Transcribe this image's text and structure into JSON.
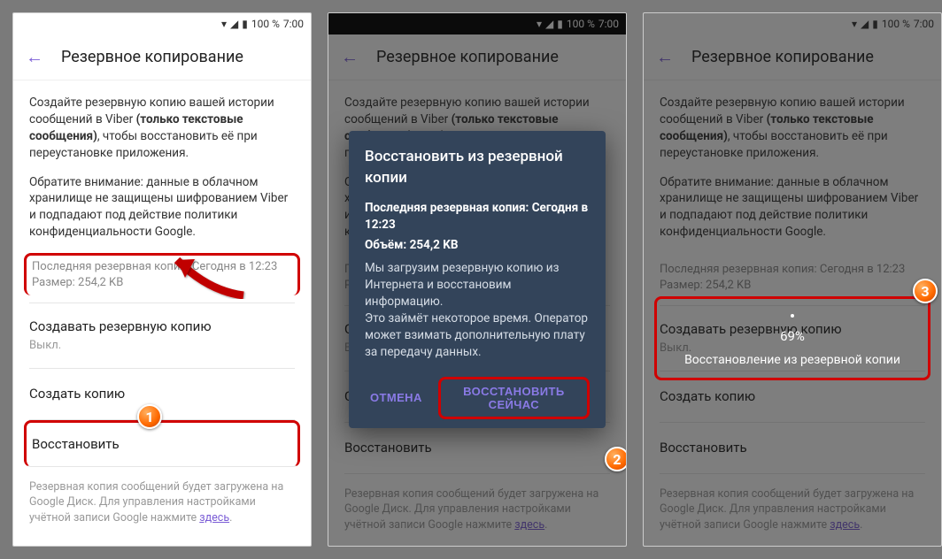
{
  "status": {
    "battery": "100 %",
    "time": "7:00"
  },
  "appbar": {
    "title": "Резервное копирование"
  },
  "desc": {
    "line1_pre": "Создайте резервную копию вашей истории сообщений в Viber ",
    "line1_bold": "(только текстовые сообщения)",
    "line1_post": ", чтобы восстановить её при переустановке приложения.",
    "line2": "Обратите внимание: данные в облачном хранилище не защищены шифрованием Viber и подпадают под действие политики конфиденциальности Google."
  },
  "backup_info": {
    "last_label": "Последняя резервная копия:",
    "last_value": "Сегодня в 12:23",
    "size_label": "Размер:",
    "size_value": "254,2 KB"
  },
  "auto_section": {
    "title": "Создавать резервную копию",
    "value": "Выкл."
  },
  "actions": {
    "create": "Создать копию",
    "restore": "Восстановить"
  },
  "footer": {
    "text": "Резервная копия сообщений будет загружена на Google Диск. Для управления настройками учётной записи Google нажмите ",
    "link": "здесь"
  },
  "dialog": {
    "title": "Восстановить из резервной копии",
    "last_line": "Последняя резервная копия: Сегодня в 12:23",
    "size_line": "Объём: 254,2 KB",
    "body": "Мы загрузим резервную копию из Интернета и восстановим информацию.\nЭто займёт некоторое время. Оператор может взимать дополнительную плату за передачу данных.",
    "cancel": "ОТМЕНА",
    "ok": "ВОССТАНОВИТЬ СЕЙЧАС"
  },
  "progress": {
    "percent": "69%",
    "label": "Восстановление из резервной копии"
  },
  "badges": {
    "b1": "1",
    "b2": "2",
    "b3": "3"
  }
}
